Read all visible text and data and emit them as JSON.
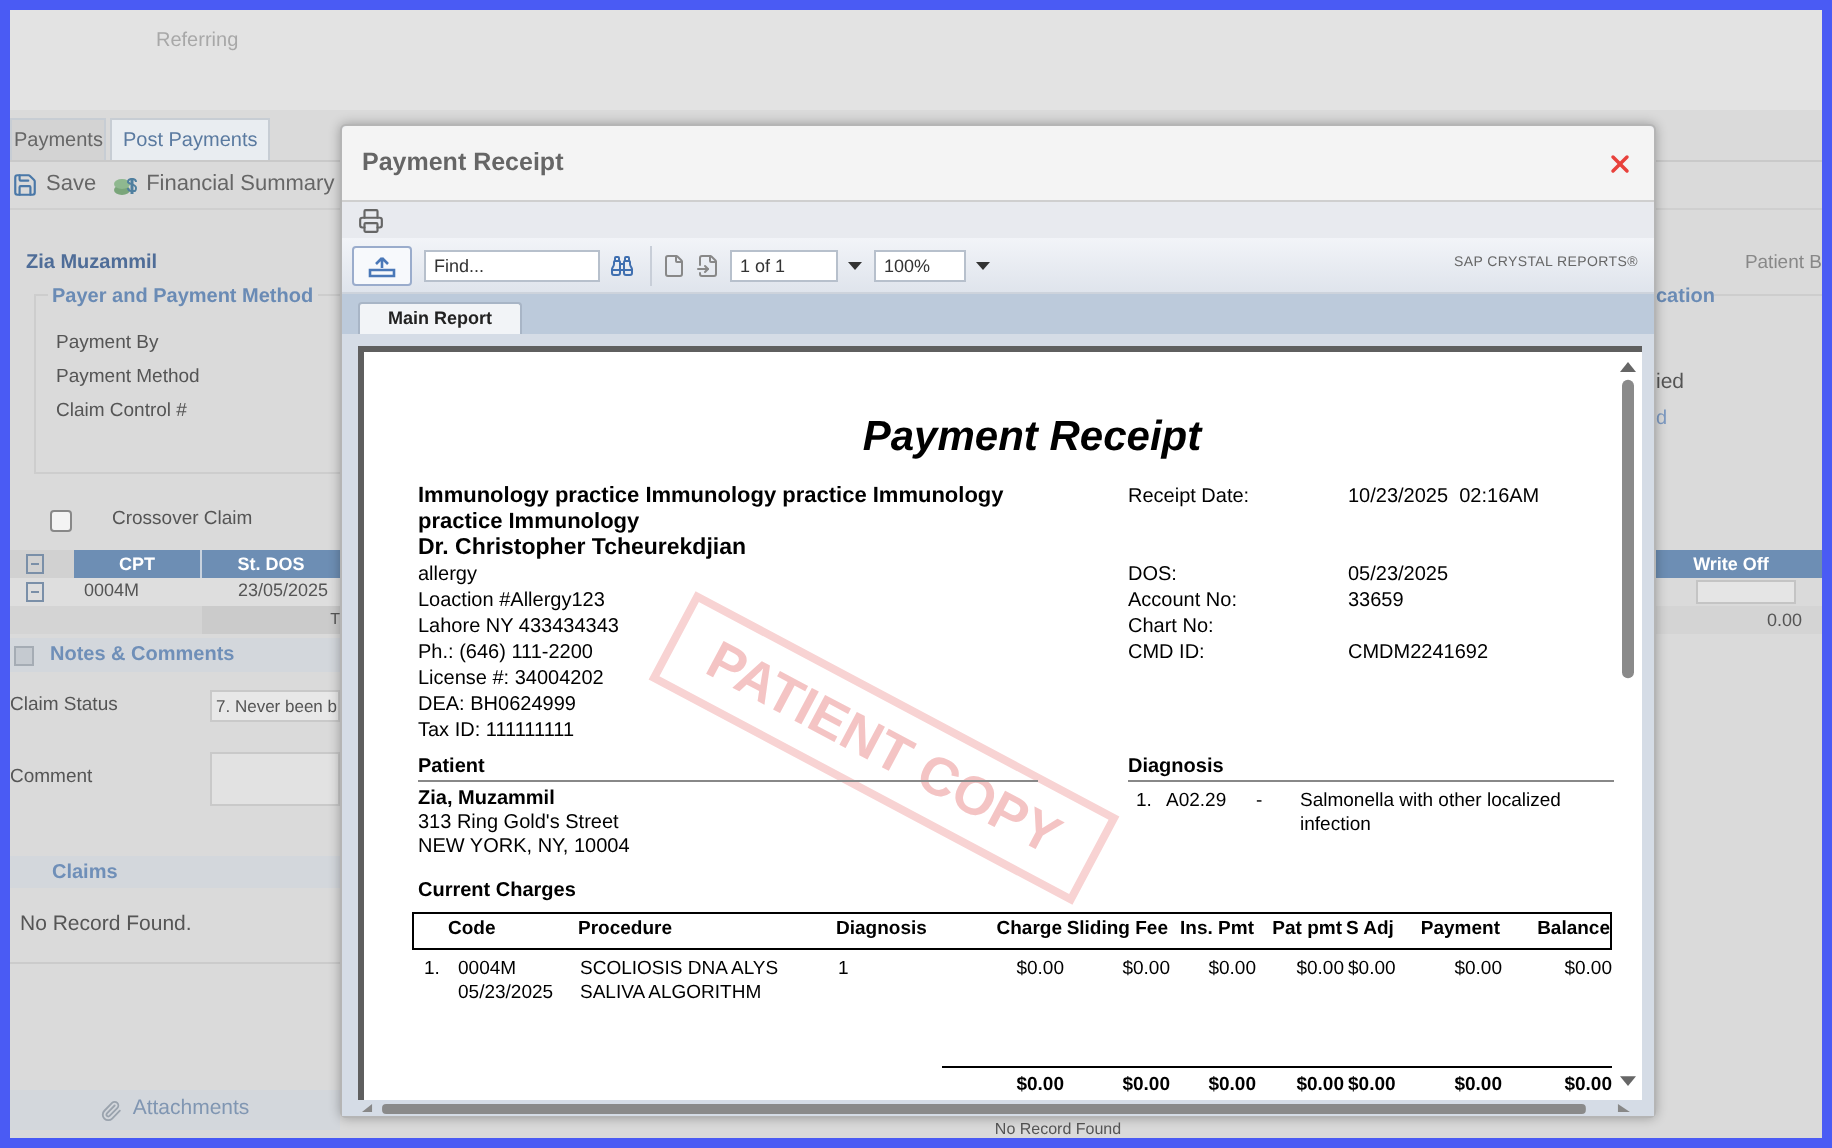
{
  "background": {
    "header_text": "Referring",
    "tabs": [
      {
        "label": "Payments",
        "selected": false
      },
      {
        "label": "Post Payments",
        "selected": true
      }
    ],
    "toolbar": [
      {
        "kind": "save",
        "label": "Save"
      },
      {
        "kind": "summary",
        "label": "Financial Summary"
      }
    ],
    "patient_name": "Zia Muzammil",
    "payer_section": {
      "title": "Payer and Payment Method",
      "fields": [
        "Payment By",
        "Payment Method",
        "Claim Control #"
      ]
    },
    "crossover": {
      "label": "Crossover Claim",
      "checked": false
    },
    "claim_table": {
      "columns": [
        "CPT",
        "St. DOS"
      ],
      "rows": [
        {
          "cpt": "0004M",
          "dos": "23/05/2025"
        }
      ],
      "total_cell": "T"
    },
    "notes": {
      "title": "Notes & Comments",
      "status_label": "Claim Status",
      "status_value": "7. Never been b",
      "comment_label": "Comment"
    },
    "claims": {
      "title": "Claims",
      "empty": "No Record Found."
    },
    "attachments": "Attachments",
    "right": {
      "patient_label": "Patient B",
      "section_title": "cation",
      "text_1": "ied",
      "text_2": "d",
      "column": "Write Off",
      "total": "0.00"
    },
    "bottom_text": "No Record Found"
  },
  "dialog": {
    "title": "Payment Receipt",
    "find_placeholder": "Find...",
    "page_value": "1 of 1",
    "zoom_value": "100%",
    "brand": "SAP CRYSTAL REPORTS®",
    "tabs": [
      {
        "label": "Main Report",
        "selected": true
      }
    ],
    "report": {
      "title": "Payment Receipt",
      "practice": "Immunology practice Immunology practice Immunology practice Immunology",
      "doctor": "Dr. Christopher Tcheurekdjian",
      "lines": [
        "allergy",
        "Loaction #Allergy123",
        "Lahore NY 433434343",
        "Ph.: (646) 111-2200",
        "License #: 34004202",
        "DEA: BH0624999",
        "Tax ID: 111111111"
      ],
      "receipt": {
        "label": "Receipt Date:",
        "value": "10/23/2025  02:16AM"
      },
      "details": [
        {
          "label": "DOS:",
          "value": "05/23/2025"
        },
        {
          "label": "Account No:",
          "value": "33659"
        },
        {
          "label": "Chart No:"
        },
        {
          "label": "CMD ID:",
          "value": "CMDM2241692"
        }
      ],
      "patient": {
        "title": "Patient",
        "name": "Zia, Muzammil",
        "address": [
          "313 Ring Gold's Street",
          "NEW YORK, NY, 10004"
        ]
      },
      "diagnosis": {
        "title": "Diagnosis",
        "items": [
          {
            "number": "1.",
            "code": "A02.29",
            "separator": "-",
            "description": "Salmonella with other localized infection"
          }
        ]
      },
      "charges": {
        "title": "Current Charges",
        "columns": [
          "Code",
          "Procedure",
          "Diagnosis",
          "Charge",
          "Sliding Fee",
          "Ins. Pmt",
          "Pat pmt",
          "S Adj",
          "Payment",
          "Balance"
        ],
        "rows": [
          {
            "number": "1.",
            "code": "0004M",
            "date": "05/23/2025",
            "procedure": [
              "SCOLIOSIS DNA ALYS",
              "SALIVA ALGORITHM"
            ],
            "diagnosis": "1",
            "amounts": [
              "$0.00",
              "$0.00",
              "$0.00",
              "$0.00",
              "$0.00",
              "$0.00",
              "$0.00"
            ]
          }
        ],
        "totals": [
          "$0.00",
          "$0.00",
          "$0.00",
          "$0.00",
          "$0.00",
          "$0.00",
          "$0.00"
        ]
      },
      "stamp": "PATIENT COPY"
    }
  }
}
